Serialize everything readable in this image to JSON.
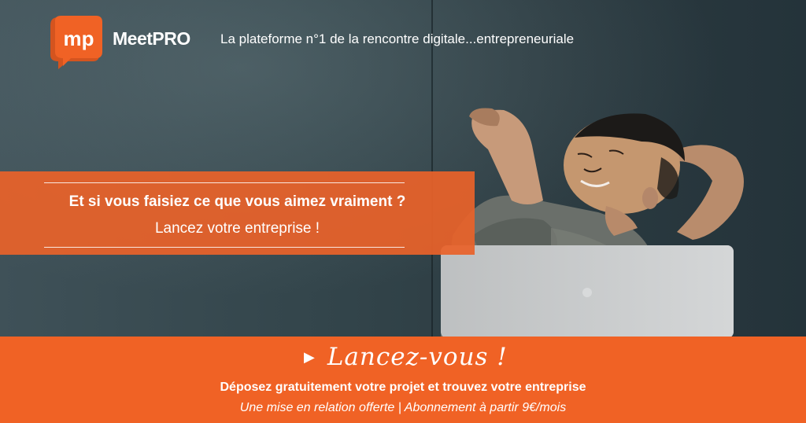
{
  "header": {
    "logo_letters": "mp",
    "brand": "MeetPRO",
    "tagline": "La plateforme n°1 de la rencontre digitale...entrepreneuriale"
  },
  "banner": {
    "headline": "Et si vous faisiez ce que vous aimez vraiment ?",
    "subline": "Lancez votre entreprise !"
  },
  "footer": {
    "cta_arrow": "▶",
    "cta": "Lancez-vous !",
    "description": "Déposez gratuitement votre projet et trouvez votre entreprise",
    "offer": "Une mise en relation offerte | Abonnement à partir 9€/mois"
  },
  "colors": {
    "accent": "#f06225",
    "banner": "#e8622a",
    "logo_dark": "#d4541f",
    "background": "#33454b"
  },
  "photo": {
    "subject": "person-relaxing-laptop"
  }
}
